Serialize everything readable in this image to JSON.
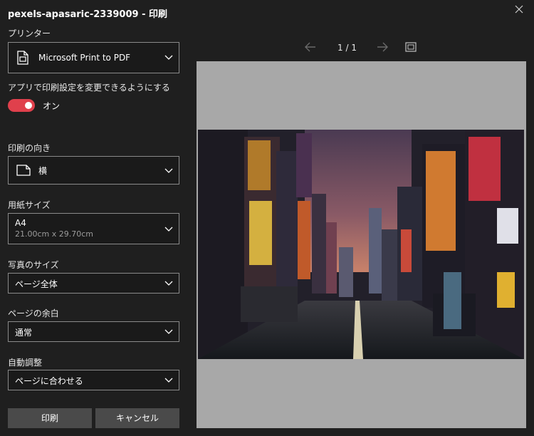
{
  "window": {
    "title": "pexels-apasaric-2339009 - 印刷"
  },
  "printer": {
    "label": "プリンター",
    "value": "Microsoft Print to PDF"
  },
  "app_settings": {
    "label": "アプリで印刷設定を変更できるようにする",
    "state": "オン"
  },
  "orientation": {
    "label": "印刷の向き",
    "value": "横"
  },
  "paper_size": {
    "label": "用紙サイズ",
    "value": "A4",
    "sub": "21.00cm x 29.70cm"
  },
  "photo_size": {
    "label": "写真のサイズ",
    "value": "ページ全体"
  },
  "margins": {
    "label": "ページの余白",
    "value": "通常"
  },
  "auto_adjust": {
    "label": "自動調整",
    "value": "ページに合わせる"
  },
  "buttons": {
    "print": "印刷",
    "cancel": "キャンセル"
  },
  "preview": {
    "page": "1",
    "sep": "/",
    "total": "1"
  },
  "colors": {
    "accent": "#e0404c",
    "background": "#1f1f1f",
    "preview_page": "#a8a8a8"
  }
}
